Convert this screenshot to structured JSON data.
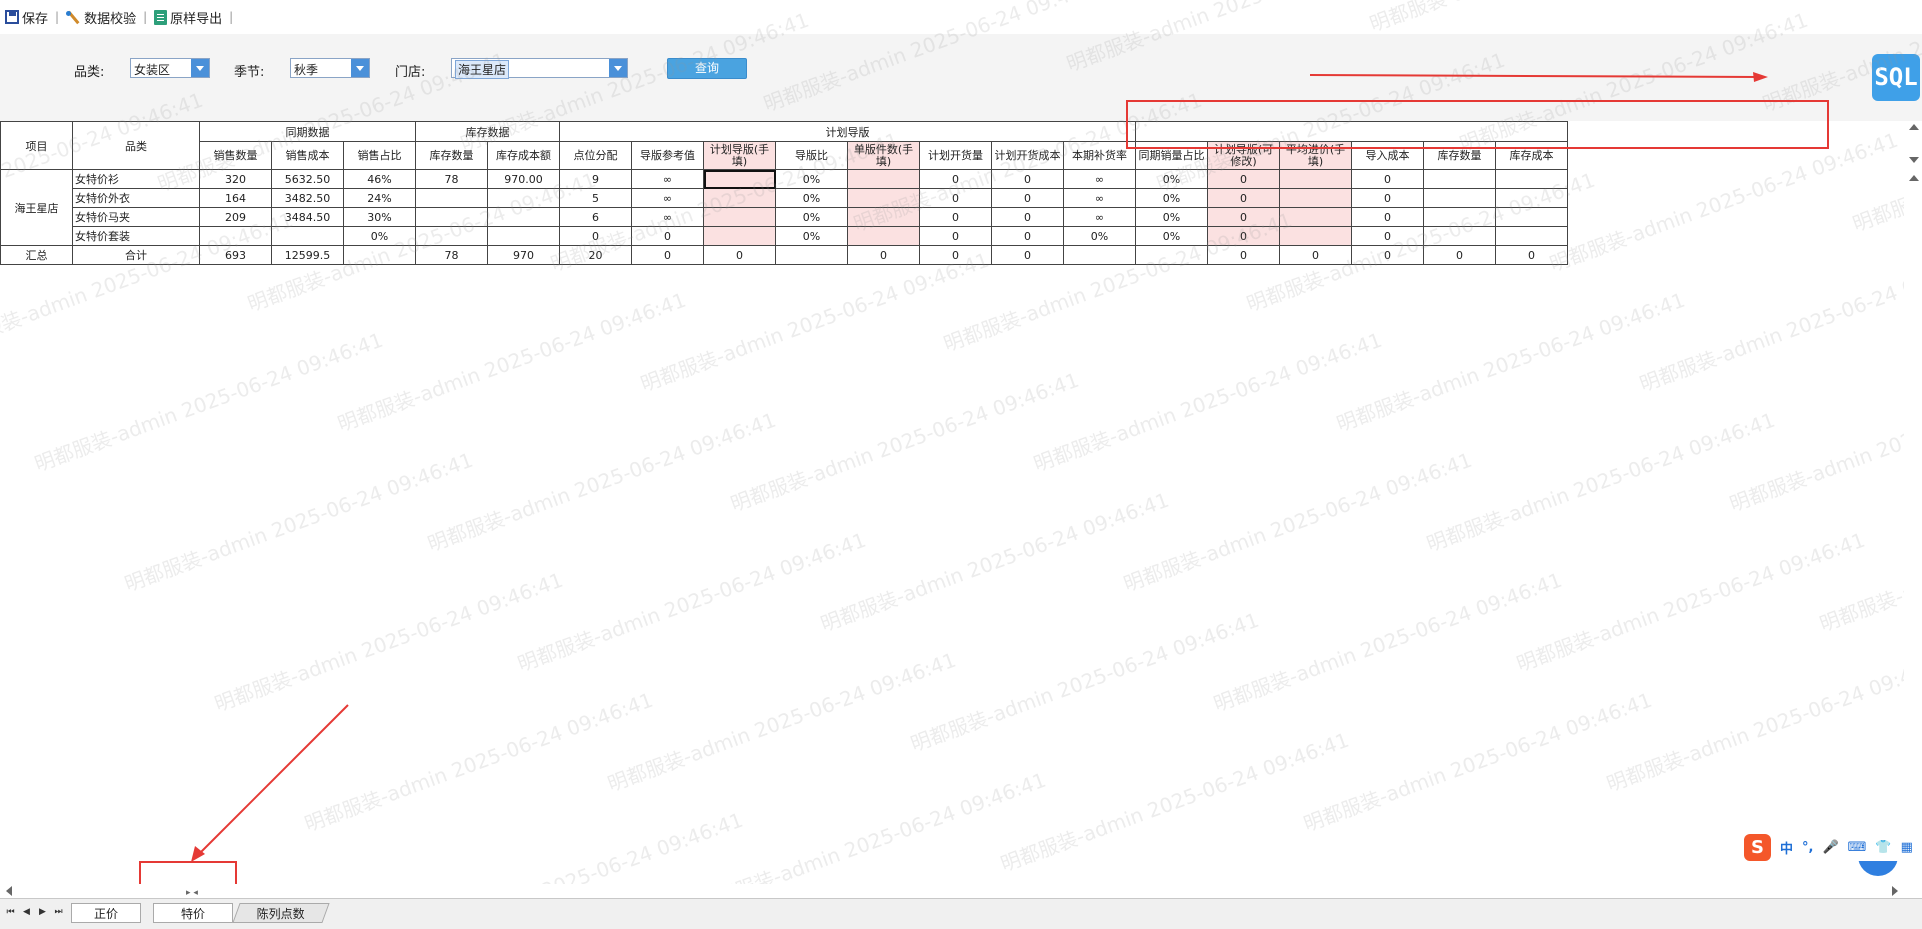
{
  "toolbar": {
    "save": "保存",
    "validate": "数据校验",
    "export": "原样导出"
  },
  "filters": {
    "category_label": "品类:",
    "category_value": "女装区",
    "season_label": "季节:",
    "season_value": "秋季",
    "store_label": "门店:",
    "store_value": "海王星店",
    "query_button": "查询"
  },
  "sql_badge": "SQL",
  "table": {
    "group_headers": {
      "item": "项目",
      "category": "品类",
      "same_period": "同期数据",
      "inventory": "库存数据",
      "plan": "计划导版"
    },
    "col_headers": [
      "销售数量",
      "销售成本",
      "销售占比",
      "库存数量",
      "库存成本额",
      "点位分配",
      "导版参考值",
      "计划导版(手填)",
      "导版比",
      "单版件数(手填)",
      "计划开货量",
      "计划开货成本",
      "本期补货率",
      "同期销量占比",
      "计划导版(可修改)",
      "平均进价(手填)",
      "导入成本",
      "库存数量",
      "库存成本"
    ],
    "store_name": "海王星店",
    "rows": [
      {
        "category": "女特价衫",
        "cells": [
          "320",
          "5632.50",
          "46%",
          "78",
          "970.00",
          "9",
          "∞",
          "",
          "0%",
          "",
          "0",
          "0",
          "∞",
          "0%",
          "0",
          "",
          "0",
          "",
          ""
        ]
      },
      {
        "category": "女特价外衣",
        "cells": [
          "164",
          "3482.50",
          "24%",
          "",
          "",
          "5",
          "∞",
          "",
          "0%",
          "",
          "0",
          "0",
          "∞",
          "0%",
          "0",
          "",
          "0",
          "",
          ""
        ]
      },
      {
        "category": "女特价马夹",
        "cells": [
          "209",
          "3484.50",
          "30%",
          "",
          "",
          "6",
          "∞",
          "",
          "0%",
          "",
          "0",
          "0",
          "∞",
          "0%",
          "0",
          "",
          "0",
          "",
          ""
        ]
      },
      {
        "category": "女特价套装",
        "cells": [
          "",
          "",
          "0%",
          "",
          "",
          "0",
          "0",
          "",
          "0%",
          "",
          "0",
          "0",
          "0%",
          "0%",
          "0",
          "",
          "0",
          "",
          ""
        ]
      }
    ],
    "total": {
      "label": "汇总",
      "category": "合计",
      "cells": [
        "693",
        "12599.5",
        "",
        "78",
        "970",
        "20",
        "0",
        "0",
        "",
        "0",
        "0",
        "0",
        "",
        "",
        "0",
        "0",
        "0",
        "0",
        "0"
      ]
    }
  },
  "watermark": "明都服装-admin 2025-06-24 09:46:41",
  "tabs": [
    "正价",
    "特价",
    "陈列点数"
  ],
  "ime": {
    "lang": "中",
    "punct": "°,"
  },
  "colors": {
    "accent": "#4a90d9",
    "editable_cell": "#fbe1e1",
    "annotation": "#e53935",
    "sql_badge": "#3fa0e8"
  }
}
